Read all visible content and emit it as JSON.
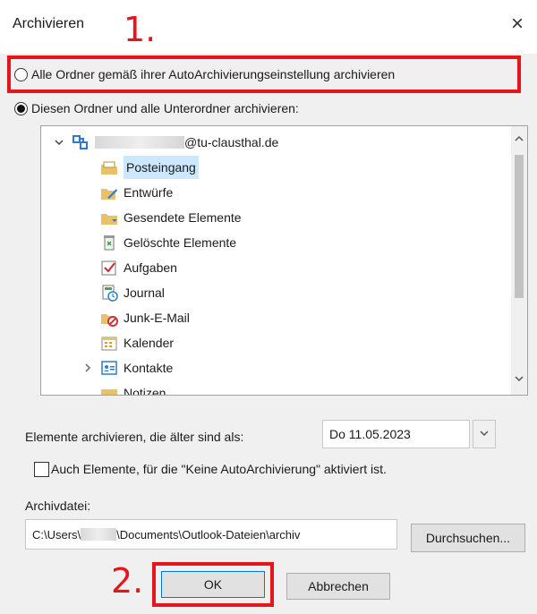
{
  "dialog": {
    "title": "Archivieren",
    "close_symbol": "×"
  },
  "annotations": {
    "step1": "1.",
    "step2": "2."
  },
  "options": {
    "radio_all": "Alle Ordner gemäß ihrer AutoArchivierungseinstellung archivieren",
    "radio_this": "Diesen Ordner und alle Unterordner archivieren:",
    "selected": "radio_this"
  },
  "tree": {
    "account": "@tu-clausthal.de",
    "items": [
      {
        "label": "Posteingang",
        "icon": "inbox-folder-icon",
        "selected": true
      },
      {
        "label": "Entwürfe",
        "icon": "drafts-folder-icon"
      },
      {
        "label": "Gesendete Elemente",
        "icon": "sent-folder-icon"
      },
      {
        "label": "Gelöschte Elemente",
        "icon": "deleted-folder-icon"
      },
      {
        "label": "Aufgaben",
        "icon": "tasks-folder-icon"
      },
      {
        "label": "Journal",
        "icon": "journal-folder-icon"
      },
      {
        "label": "Junk-E-Mail",
        "icon": "junk-folder-icon"
      },
      {
        "label": "Kalender",
        "icon": "calendar-folder-icon"
      },
      {
        "label": "Kontakte",
        "icon": "contacts-folder-icon"
      },
      {
        "label": "Notizen",
        "icon": "notes-folder-icon"
      }
    ]
  },
  "older_than": {
    "label": "Elemente archivieren, die älter sind als:",
    "value": "Do 11.05.2023"
  },
  "no_autoarchive": {
    "label": "Auch Elemente, für die \"Keine AutoArchivierung\" aktiviert ist."
  },
  "archive_file": {
    "label": "Archivdatei:",
    "path_prefix": "C:\\Users\\",
    "path_suffix": "\\Documents\\Outlook-Dateien\\archiv",
    "browse_label": "Durchsuchen..."
  },
  "buttons": {
    "ok": "OK",
    "cancel": "Abbrechen"
  },
  "colors": {
    "highlight": "#e8141b",
    "selection": "#cce8ff",
    "accent": "#2c7bd1"
  }
}
